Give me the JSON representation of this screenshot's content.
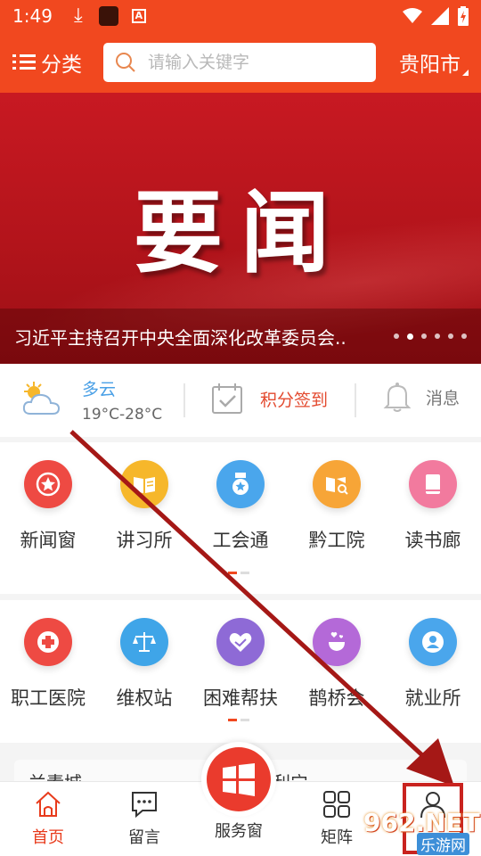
{
  "status_bar": {
    "time": "1:49",
    "download_icon": "download-icon",
    "app_icon_letter": "A"
  },
  "header": {
    "category_label": "分类",
    "search_placeholder": "请输入关键字",
    "city": "贵阳市"
  },
  "banner": {
    "title": "要闻",
    "caption": "习近平主持召开中央全面深化改革委员会..",
    "slide_count": 6,
    "active_slide": 2
  },
  "weather": {
    "condition": "多云",
    "temperature": "19°C-28°C"
  },
  "signin": {
    "label": "积分签到"
  },
  "messages": {
    "label": "消息"
  },
  "service_grid_1": [
    {
      "label": "新闻窗",
      "color": "#ee4a43",
      "icon": "star-badge-icon"
    },
    {
      "label": "讲习所",
      "color": "#f6b72b",
      "icon": "open-book-icon"
    },
    {
      "label": "工会通",
      "color": "#4aa6ec",
      "icon": "medal-icon"
    },
    {
      "label": "黔工院",
      "color": "#f7a537",
      "icon": "book-search-icon"
    },
    {
      "label": "读书廊",
      "color": "#f27a9e",
      "icon": "book-icon"
    }
  ],
  "service_grid_2": [
    {
      "label": "职工医院",
      "color": "#ee4a43",
      "icon": "medical-cross-icon"
    },
    {
      "label": "维权站",
      "color": "#3fa5e8",
      "icon": "scales-icon"
    },
    {
      "label": "困难帮扶",
      "color": "#8e6ad6",
      "icon": "heart-hands-icon"
    },
    {
      "label": "鹊桥会",
      "color": "#b469d8",
      "icon": "hearts-cup-icon"
    },
    {
      "label": "就业所",
      "color": "#4aa6ec",
      "icon": "person-badge-icon"
    }
  ],
  "promo": {
    "left_text": "兰素城",
    "right_text": "利宁"
  },
  "tabbar": {
    "home": "首页",
    "comments": "留言",
    "service": "服务窗",
    "matrix": "矩阵",
    "mine": "我的"
  },
  "watermark": {
    "line1": "962.NET",
    "line2": "乐游网"
  },
  "colors": {
    "brand": "#f1481f",
    "banner_red": "#c81922",
    "annotation": "#c9231f"
  }
}
